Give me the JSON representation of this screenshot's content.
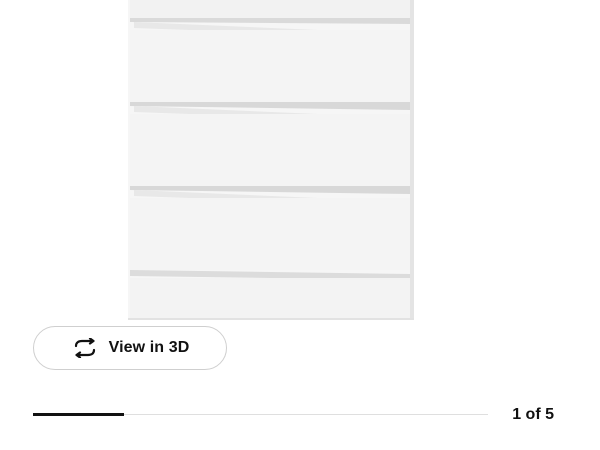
{
  "product_image": {
    "subject": "white chest of drawers"
  },
  "view_3d": {
    "label": "View in 3D",
    "icon": "rotate-3d-icon"
  },
  "carousel": {
    "counter_text": "1 of 5",
    "current": 1,
    "total": 5,
    "progress_fraction": 0.2
  },
  "colors": {
    "text": "#111111",
    "track": "#dfdfdf",
    "progress": "#111111",
    "button_border": "#cfcfcf"
  }
}
